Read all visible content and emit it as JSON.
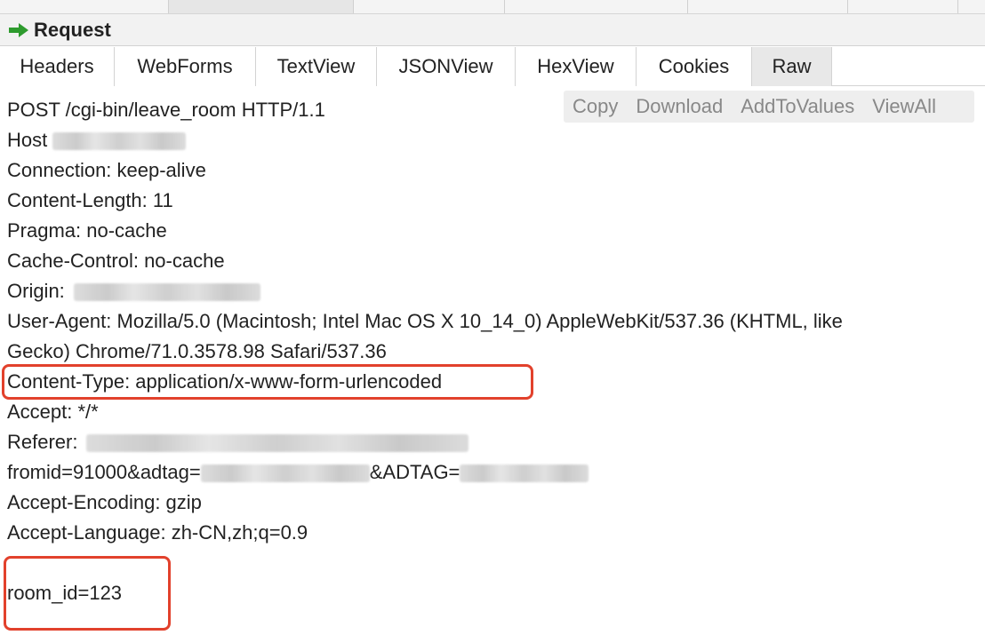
{
  "request_bar": {
    "title": "Request",
    "accent": "#2e9b2e"
  },
  "tabs": [
    {
      "label": "Headers",
      "active": false
    },
    {
      "label": "WebForms",
      "active": false
    },
    {
      "label": "TextView",
      "active": false
    },
    {
      "label": "JSONView",
      "active": false
    },
    {
      "label": "HexView",
      "active": false
    },
    {
      "label": "Cookies",
      "active": false
    },
    {
      "label": "Raw",
      "active": true
    }
  ],
  "actions": [
    "Copy",
    "Download",
    "AddToValues",
    "ViewAll"
  ],
  "raw": {
    "request_line": "POST /cgi-bin/leave_room HTTP/1.1",
    "host_label": "Host",
    "connection": "Connection: keep-alive",
    "content_length": "Content-Length: 11",
    "pragma": "Pragma: no-cache",
    "cache_control": "Cache-Control: no-cache",
    "origin_label": "Origin:",
    "user_agent_1": "User-Agent: Mozilla/5.0 (Macintosh; Intel Mac OS X 10_14_0) AppleWebKit/537.36 (KHTML, like",
    "user_agent_2": "Gecko) Chrome/71.0.3578.98 Safari/537.36",
    "content_type": "Content-Type: application/x-www-form-urlencoded",
    "accept": "Accept: */*",
    "referer_label": "Referer:",
    "referer_query_1": "fromid=91000&adtag=",
    "referer_query_2": "&ADTAG=",
    "accept_encoding": "Accept-Encoding: gzip",
    "accept_language": "Accept-Language: zh-CN,zh;q=0.9",
    "body": "room_id=123"
  },
  "highlight_color": "#e2412c"
}
